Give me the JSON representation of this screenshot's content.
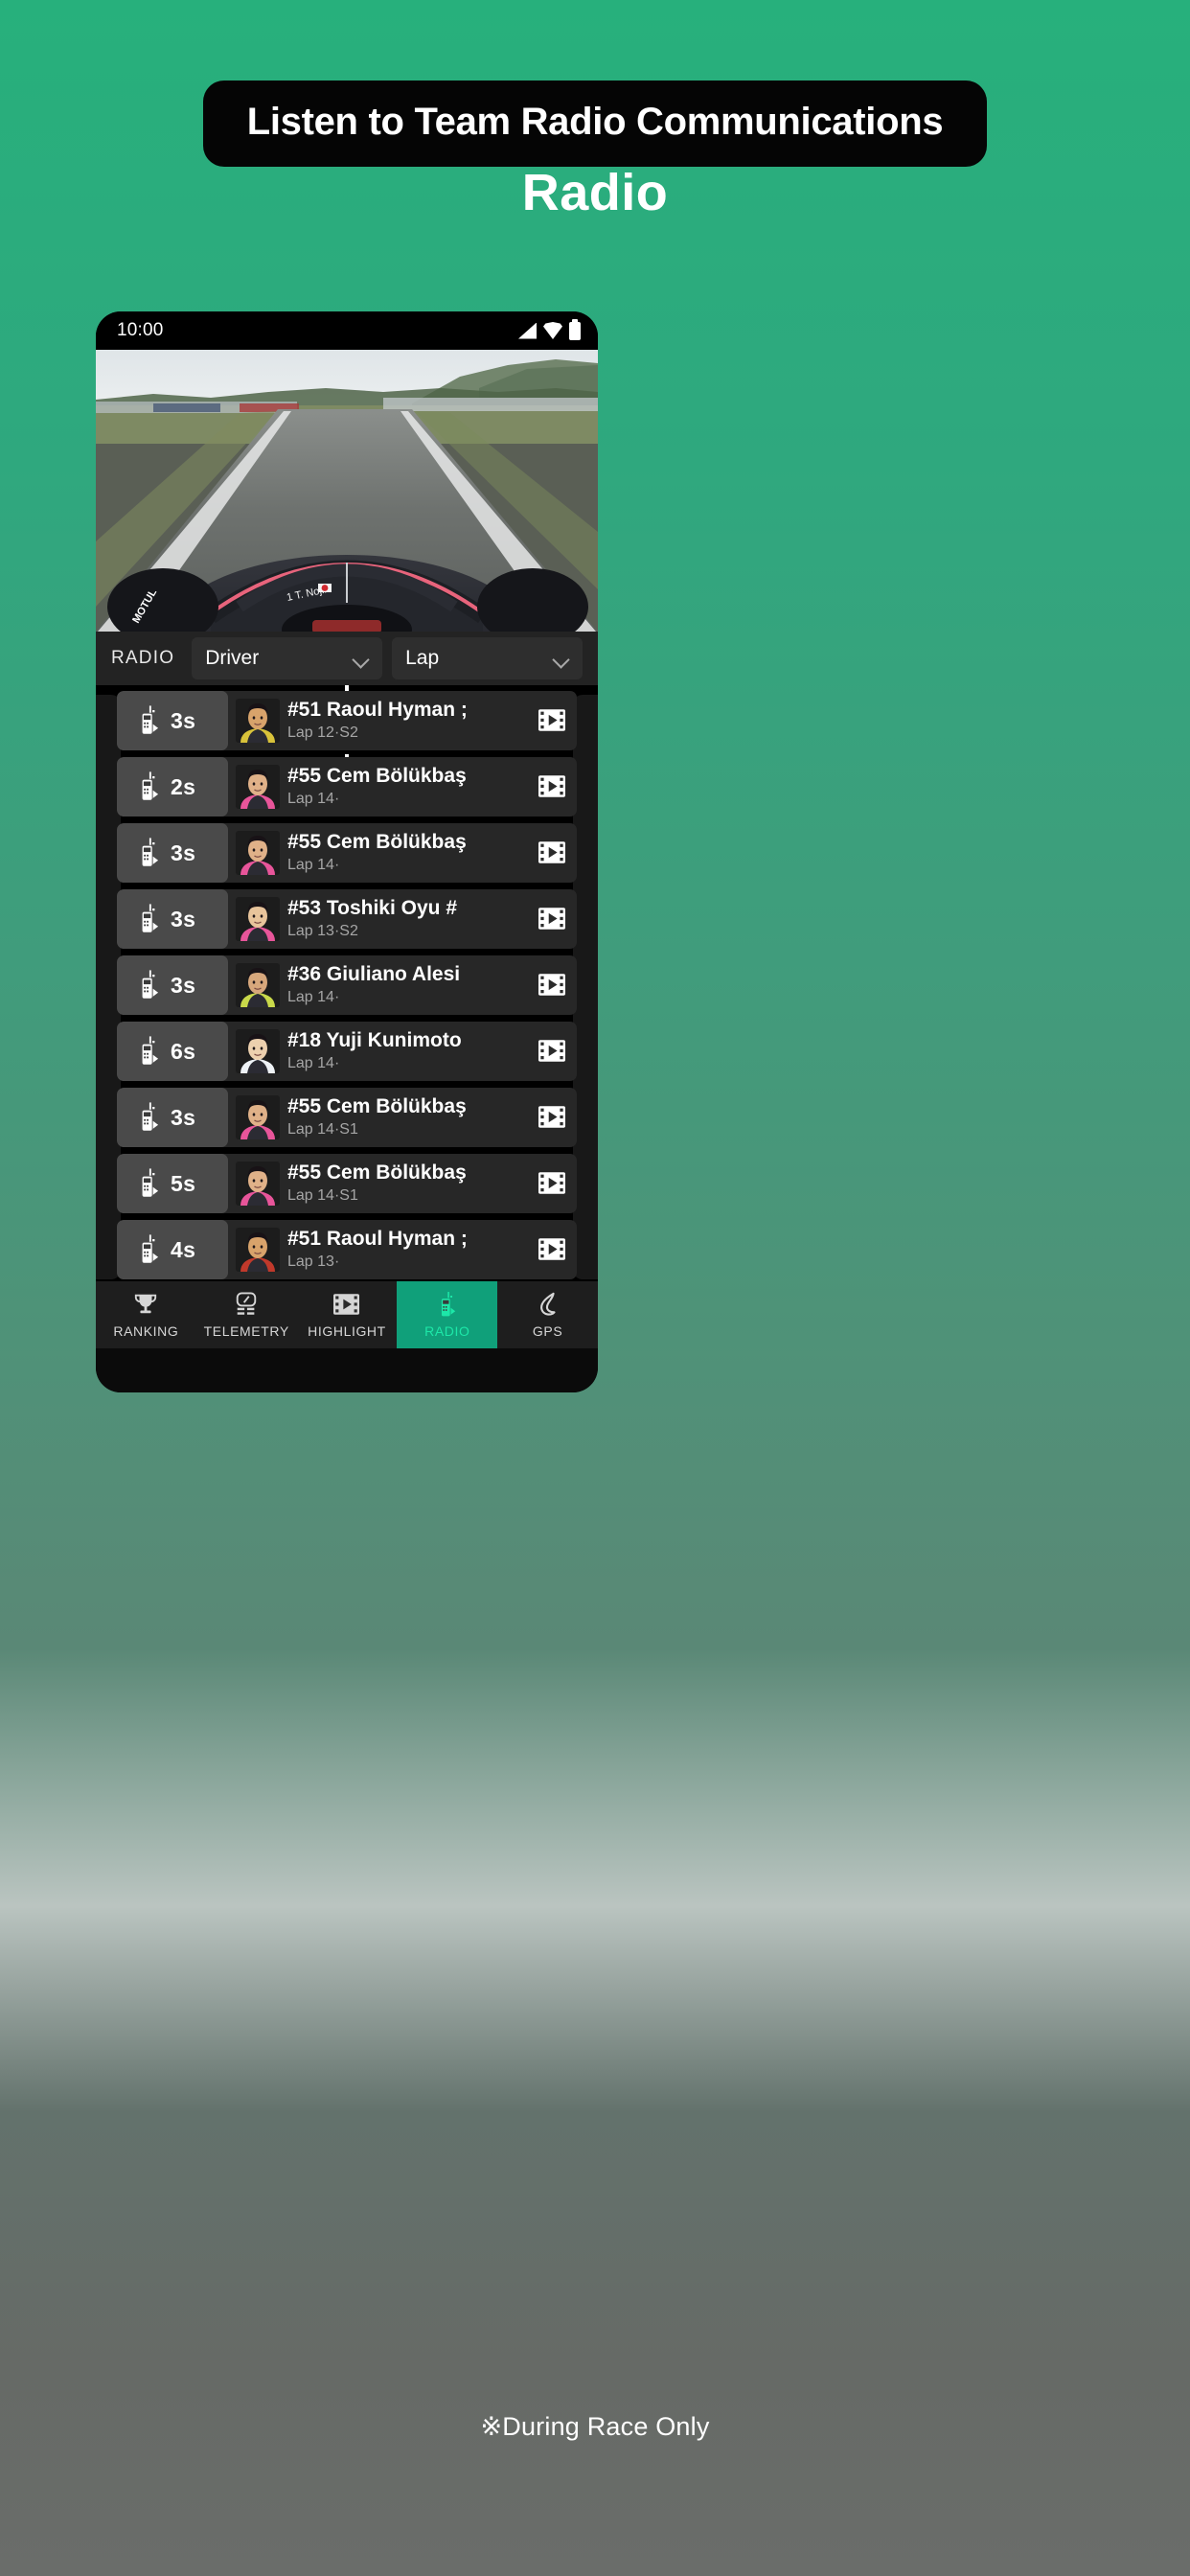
{
  "banner": {
    "text": "Listen to Team Radio Communications"
  },
  "page": {
    "title": "Radio"
  },
  "footer": {
    "note": "※During Race Only"
  },
  "status_bar": {
    "time": "10:00",
    "icons": [
      "signal-icon",
      "wifi-icon",
      "battery-icon"
    ]
  },
  "video": {
    "overlay_driver": "1  T. Nojiri",
    "sponsor": "MOTUL"
  },
  "filter_bar": {
    "label": "RADIO",
    "driver_dropdown": {
      "value": "Driver",
      "icon": "chevron-down-icon"
    },
    "lap_dropdown": {
      "value": "Lap",
      "icon": "chevron-down-icon"
    }
  },
  "radio_list": {
    "rows": [
      {
        "duration": "3s",
        "name": "#51 Raoul Hyman ;",
        "lap": "Lap 12·S2",
        "skin": "#d8a36b",
        "suit": "#d8c23a"
      },
      {
        "duration": "2s",
        "name": "#55 Cem Bölükbaş",
        "lap": "Lap 14·",
        "skin": "#e0b188",
        "suit": "#e8559a"
      },
      {
        "duration": "3s",
        "name": "#55 Cem Bölükbaş",
        "lap": "Lap 14·",
        "skin": "#e0b188",
        "suit": "#e8559a"
      },
      {
        "duration": "3s",
        "name": "#53 Toshiki Oyu #",
        "lap": "Lap 13·S2",
        "skin": "#e8c49b",
        "suit": "#e8559a"
      },
      {
        "duration": "3s",
        "name": "#36 Giuliano Alesi",
        "lap": "Lap 14·",
        "skin": "#d7a77c",
        "suit": "#c9d94a"
      },
      {
        "duration": "6s",
        "name": "#18 Yuji Kunimoto",
        "lap": "Lap 14·",
        "skin": "#ecd0ae",
        "suit": "#eef2f6"
      },
      {
        "duration": "3s",
        "name": "#55 Cem Bölükbaş",
        "lap": "Lap 14·S1",
        "skin": "#e0b188",
        "suit": "#e8559a"
      },
      {
        "duration": "5s",
        "name": "#55 Cem Bölükbaş",
        "lap": "Lap 14·S1",
        "skin": "#e0b188",
        "suit": "#e8559a"
      },
      {
        "duration": "4s",
        "name": "#51 Raoul Hyman ;",
        "lap": "Lap 13·",
        "skin": "#d8a36b",
        "suit": "#c0392b"
      }
    ]
  },
  "bottom_nav": {
    "items": [
      {
        "label": "RANKING",
        "icon": "trophy-icon",
        "active": false
      },
      {
        "label": "TELEMETRY",
        "icon": "gauge-icon",
        "active": false
      },
      {
        "label": "HIGHLIGHT",
        "icon": "film-icon",
        "active": false
      },
      {
        "label": "RADIO",
        "icon": "walkie-talkie-icon",
        "active": true
      },
      {
        "label": "GPS",
        "icon": "gps-track-icon",
        "active": false
      }
    ]
  },
  "colors": {
    "brand_green": "#27b07c",
    "accent_green": "#10a07a",
    "active_text": "#1de7a8",
    "banner_bg": "#050505"
  }
}
